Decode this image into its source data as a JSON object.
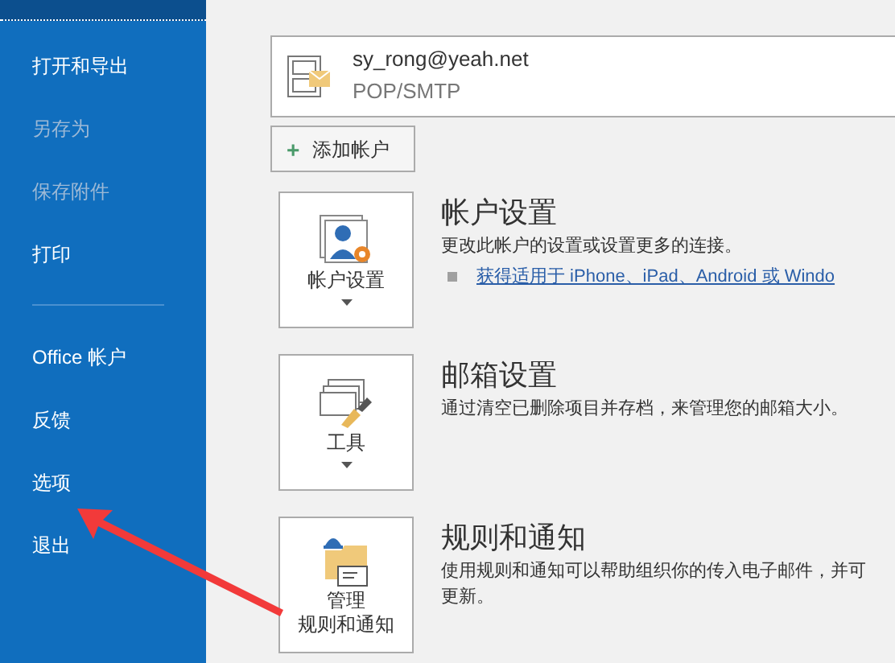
{
  "sidebar": {
    "items": [
      {
        "label": "打开和导出",
        "disabled": false,
        "kind": "item"
      },
      {
        "label": "另存为",
        "disabled": true,
        "kind": "item"
      },
      {
        "label": "保存附件",
        "disabled": true,
        "kind": "item"
      },
      {
        "label": "打印",
        "disabled": false,
        "kind": "item"
      },
      {
        "kind": "divider"
      },
      {
        "label": "Office 帐户",
        "disabled": false,
        "kind": "item"
      },
      {
        "label": "反馈",
        "disabled": false,
        "kind": "item"
      },
      {
        "label": "选项",
        "disabled": false,
        "kind": "item"
      },
      {
        "label": "退出",
        "disabled": false,
        "kind": "item"
      }
    ]
  },
  "account": {
    "email": "sy_rong@yeah.net",
    "type": "POP/SMTP"
  },
  "add_account_button": {
    "icon": "+",
    "label": "添加帐户"
  },
  "sections": [
    {
      "kind": "account",
      "button": [
        "帐户设置"
      ],
      "title": "帐户设置",
      "description": "更改此帐户的设置或设置更多的连接。",
      "link": "获得适用于 iPhone、iPad、Android 或 Windo",
      "dropdown": true
    },
    {
      "kind": "tools",
      "button": [
        "工具"
      ],
      "title": "邮箱设置",
      "description": "通过清空已删除项目并存档，来管理您的邮箱大小。",
      "dropdown": true
    },
    {
      "kind": "rules",
      "button": [
        "管理",
        "规则和通知"
      ],
      "title": "规则和通知",
      "description": "使用规则和通知可以帮助组织你的传入电子邮件，并可",
      "description_2": "更新。",
      "dropdown": false
    }
  ]
}
